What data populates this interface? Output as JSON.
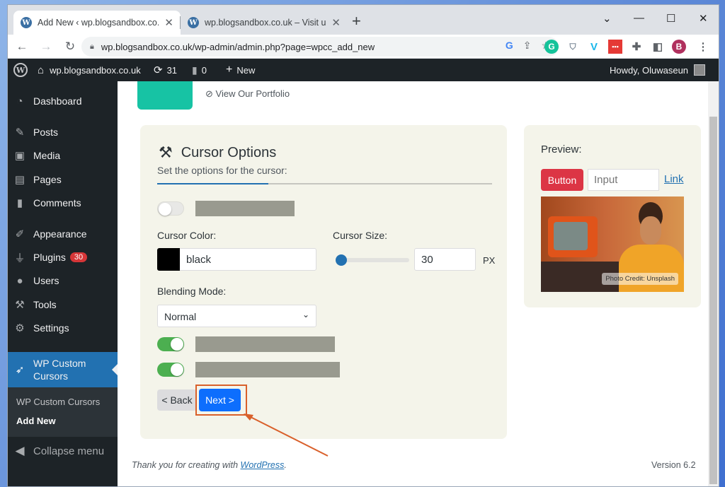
{
  "browser": {
    "tabs": [
      {
        "title": "Add New ‹ wp.blogsandbox.co.uk",
        "active": true
      },
      {
        "title": "wp.blogsandbox.co.uk – Visit us f",
        "active": false
      }
    ],
    "new_tab": "+",
    "window_controls": [
      "⌄",
      "—",
      "☐",
      "✕"
    ],
    "url": "wp.blogsandbox.co.uk/wp-admin/admin.php?page=wpcc_add_new",
    "profile_initial": "B"
  },
  "admin_bar": {
    "site_name": "wp.blogsandbox.co.uk",
    "updates_count": "31",
    "comments_count": "0",
    "new_label": "New",
    "greeting": "Howdy, Oluwaseun"
  },
  "sidebar": {
    "items": [
      {
        "label": "Dashboard",
        "icon": "dashboard-icon"
      },
      {
        "label": "Posts",
        "icon": "pin-icon"
      },
      {
        "label": "Media",
        "icon": "media-icon"
      },
      {
        "label": "Pages",
        "icon": "pages-icon"
      },
      {
        "label": "Comments",
        "icon": "comment-icon"
      },
      {
        "label": "Appearance",
        "icon": "brush-icon"
      },
      {
        "label": "Plugins",
        "icon": "plugin-icon",
        "badge": "30"
      },
      {
        "label": "Users",
        "icon": "user-icon"
      },
      {
        "label": "Tools",
        "icon": "wrench-icon"
      },
      {
        "label": "Settings",
        "icon": "settings-icon"
      }
    ],
    "current": {
      "label_line1": "WP Custom",
      "label_line2": "Cursors"
    },
    "submenu": [
      "WP Custom Cursors",
      "Add New"
    ],
    "collapse": "Collapse menu"
  },
  "content": {
    "portfolio_link": "View Our Portfolio",
    "options": {
      "title": "Cursor Options",
      "subtitle": "Set the options for the cursor:",
      "cursor_color_label": "Cursor Color:",
      "cursor_color_value": "black",
      "cursor_size_label": "Cursor Size:",
      "cursor_size_value": "30",
      "px_label": "PX",
      "blending_label": "Blending Mode:",
      "blending_value": "Normal",
      "back_label": "< Back",
      "next_label": "Next >",
      "toggles": [
        false,
        true,
        true
      ]
    },
    "preview": {
      "title": "Preview:",
      "button_label": "Button",
      "input_placeholder": "Input",
      "link_label": "Link",
      "photo_credit": "Photo Credit: Unsplash"
    },
    "footer": {
      "thanks_prefix": "Thank you for creating with ",
      "thanks_link": "WordPress",
      "thanks_suffix": ".",
      "version": "Version 6.2"
    }
  },
  "colors": {
    "accent": "#2271b1",
    "next_button": "#0d6efd",
    "preview_button": "#dc3545",
    "highlight": "#d9602b"
  }
}
